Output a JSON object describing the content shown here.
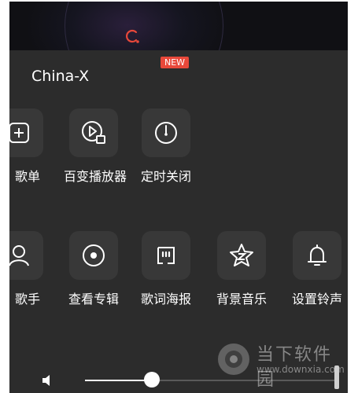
{
  "panel": {
    "title": "China-X"
  },
  "row1": [
    {
      "label": "歌单",
      "icon": "add-playlist-icon"
    },
    {
      "label": "百变播放器",
      "icon": "player-skin-icon"
    },
    {
      "label": "定时关闭",
      "icon": "timer-icon",
      "badge": "NEW"
    }
  ],
  "row2": [
    {
      "label": "歌手",
      "icon": "singer-icon"
    },
    {
      "label": "查看专辑",
      "icon": "album-icon"
    },
    {
      "label": "歌词海报",
      "icon": "lyrics-poster-icon"
    },
    {
      "label": "背景音乐",
      "icon": "background-music-icon"
    },
    {
      "label": "设置铃声",
      "icon": "ringtone-bell-icon"
    }
  ],
  "volume": {
    "level": 0.29
  },
  "watermark": {
    "name": "当下软件园",
    "url": "www.downxia.com"
  },
  "colors": {
    "panel_bg": "#2c2c2c",
    "tile_bg": "#383838",
    "badge": "#e8483a",
    "accent_glyph": "#e8483a"
  }
}
